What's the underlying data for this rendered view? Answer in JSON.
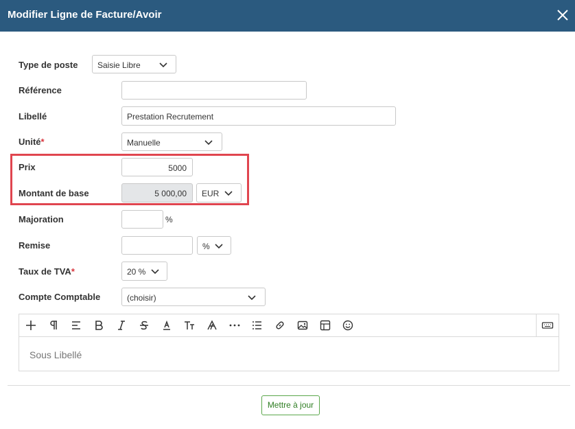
{
  "dialog": {
    "title": "Modifier Ligne de Facture/Avoir",
    "close_icon": "close-icon"
  },
  "fields": {
    "type_poste": {
      "label": "Type de poste",
      "value": "Saisie Libre"
    },
    "reference": {
      "label": "Référence",
      "value": ""
    },
    "libelle": {
      "label": "Libellé",
      "value": "Prestation Recrutement"
    },
    "unite": {
      "label": "Unité",
      "required_mark": "*",
      "value": "Manuelle"
    },
    "prix": {
      "label": "Prix",
      "value": "5000"
    },
    "montant_base": {
      "label": "Montant de base",
      "value": "5 000,00",
      "currency": "EUR"
    },
    "majoration": {
      "label": "Majoration",
      "value": "",
      "unit": "%"
    },
    "remise": {
      "label": "Remise",
      "value": "",
      "unit": "%"
    },
    "taux_tva": {
      "label": "Taux de TVA",
      "required_mark": "*",
      "value": "20 %"
    },
    "compte_comptable": {
      "label": "Compte Comptable",
      "value": "(choisir)"
    }
  },
  "editor": {
    "placeholder": "Sous Libellé",
    "toolbar": [
      "plus-icon",
      "paragraph-icon",
      "align-icon",
      "bold-icon",
      "italic-icon",
      "strikethrough-icon",
      "underline-color-icon",
      "font-size-icon",
      "font-style-icon",
      "more-icon",
      "list-icon",
      "link-icon",
      "image-icon",
      "table-icon",
      "emoji-icon",
      "keyboard-icon"
    ]
  },
  "actions": {
    "submit_label": "Mettre à jour"
  },
  "colors": {
    "header": "#2b5a7f",
    "highlight": "#e0454f",
    "required": "#d9363e",
    "submit": "#2e7d22"
  }
}
